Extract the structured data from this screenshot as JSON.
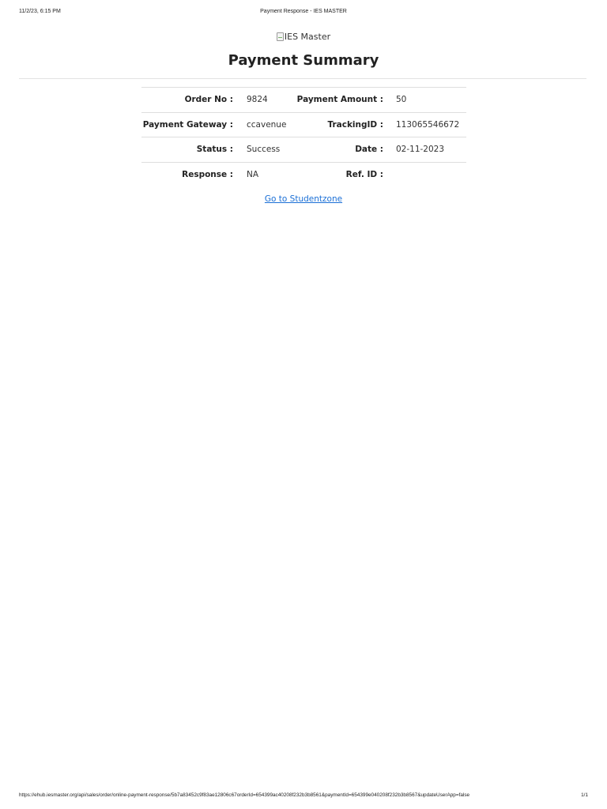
{
  "print_header": {
    "datetime": "11/2/23, 6:15 PM",
    "title": "Payment Response - IES MASTER"
  },
  "logo": {
    "alt_text": "IES Master",
    "icon": "broken-image-icon"
  },
  "page_title": "Payment Summary",
  "summary": {
    "rows": [
      {
        "label1": "Order No :",
        "value1": "9824",
        "label2": "Payment Amount :",
        "value2": "50"
      },
      {
        "label1": "Payment Gateway :",
        "value1": "ccavenue",
        "label2": "TrackingID :",
        "value2": "113065546672"
      },
      {
        "label1": "Status :",
        "value1": "Success",
        "label2": "Date :",
        "value2": "02-11-2023"
      },
      {
        "label1": "Response :",
        "value1": "NA",
        "label2": "Ref. ID :",
        "value2": ""
      }
    ]
  },
  "studentzone_link": "Go to Studentzone",
  "print_footer": {
    "url": "https://ehub.iesmaster.org/api/sales/order/online-payment-response/5b7a83452c9f83ae12806c67orderId=654399ac40208f232b3b8561&paymentId=654399e040208f232b3b8567&updateUserApp=false",
    "page": "1/1"
  },
  "colors": {
    "link": "#1a6fd6",
    "rule": "#dedede",
    "text": "#222222"
  }
}
